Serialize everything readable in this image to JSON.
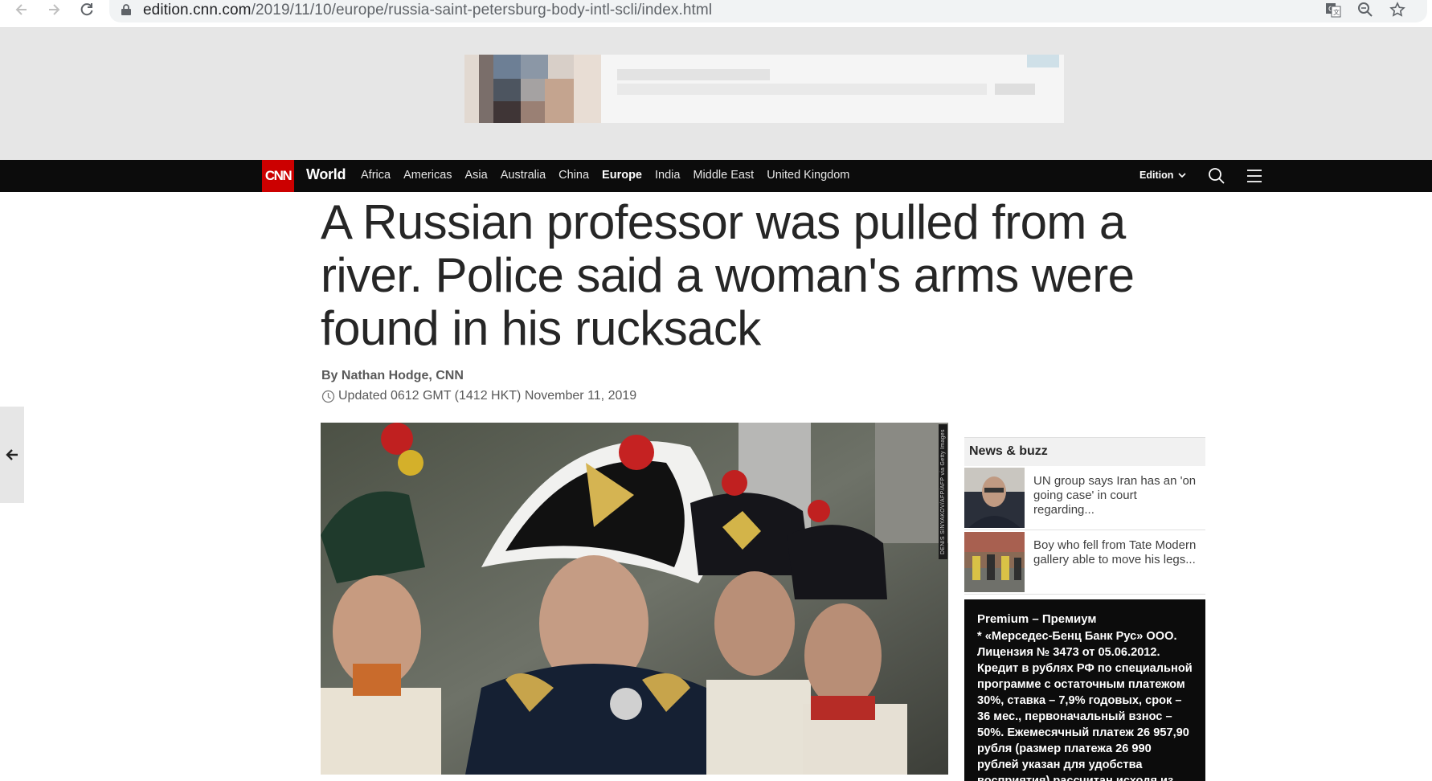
{
  "browser": {
    "url_domain": "edition.cnn.com",
    "url_path": "/2019/11/10/europe/russia-saint-petersburg-body-intl-scli/index.html"
  },
  "nav": {
    "logo": "CNN",
    "section": "World",
    "links": [
      "Africa",
      "Americas",
      "Asia",
      "Australia",
      "China",
      "Europe",
      "India",
      "Middle East",
      "United Kingdom"
    ],
    "active": "Europe",
    "edition_label": "Edition"
  },
  "article": {
    "headline": "A Russian professor was pulled from a river. Police said a woman's arms were found in his rucksack",
    "byline": "By Nathan Hodge, CNN",
    "updated": "Updated 0612 GMT (1412 HKT) November 11, 2019",
    "photo_credit": "DENIS SINYAKOV/AFP/AFP via Getty Images"
  },
  "sidebar": {
    "header": "News & buzz",
    "items": [
      {
        "text": "UN group says Iran has an 'on going case' in court regarding..."
      },
      {
        "text": "Boy who fell from Tate Modern gallery able to move his legs..."
      }
    ]
  },
  "sponsored": {
    "title": "Premium – Премиум",
    "body": "* «Мерседес-Бенц Банк Рус» ООО. Лицензия № 3473 от 05.06.2012. Кредит в рублях РФ по специальной программе с остаточным платежом 30%, ставка – 7,9% годовых, срок – 36 мес., первоначальный взнос – 50%. Ежемесячный платеж 26 957,90 рубля (размер платежа 26 990 рублей указан для удобства восприятия) рассчитан исходя из стоимости а/м"
  },
  "colors": {
    "cnn_red": "#cc0000",
    "nav_bg": "#0c0c0c",
    "headline": "#262626"
  }
}
